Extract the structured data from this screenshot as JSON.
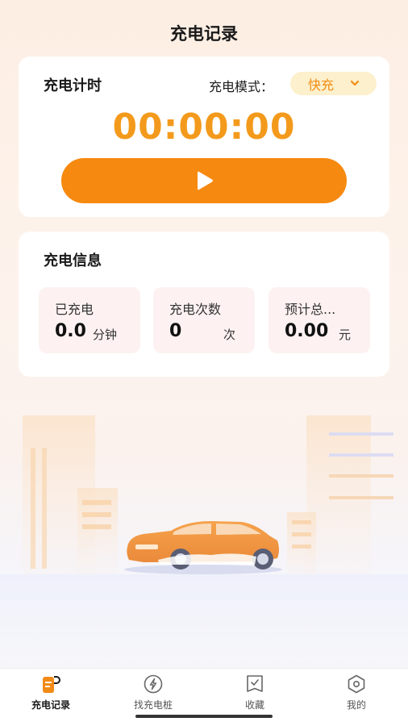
{
  "header": {
    "title": "充电记录"
  },
  "timer_card": {
    "heading": "充电计时",
    "mode_label": "充电模式：",
    "mode_value": "快充",
    "timer": "00:00:00",
    "play_icon": "play-icon"
  },
  "info_card": {
    "heading": "充电信息",
    "stats": [
      {
        "label": "已充电",
        "value": "0.0",
        "unit": "分钟"
      },
      {
        "label": "充电次数",
        "value": "0",
        "unit": "次"
      },
      {
        "label": "预计总...",
        "value": "0.00",
        "unit": "元"
      }
    ]
  },
  "tabbar": {
    "items": [
      {
        "label": "充电记录",
        "icon": "charging-record-icon",
        "active": true
      },
      {
        "label": "找充电桩",
        "icon": "lightning-icon",
        "active": false
      },
      {
        "label": "收藏",
        "icon": "bookmark-icon",
        "active": false
      },
      {
        "label": "我的",
        "icon": "profile-hexagon-icon",
        "active": false
      }
    ]
  },
  "colors": {
    "accent": "#f6890f",
    "timer": "#f39a1c",
    "mode_bg": "#fdf0cc",
    "stat_bg": "#fdf2f1"
  }
}
